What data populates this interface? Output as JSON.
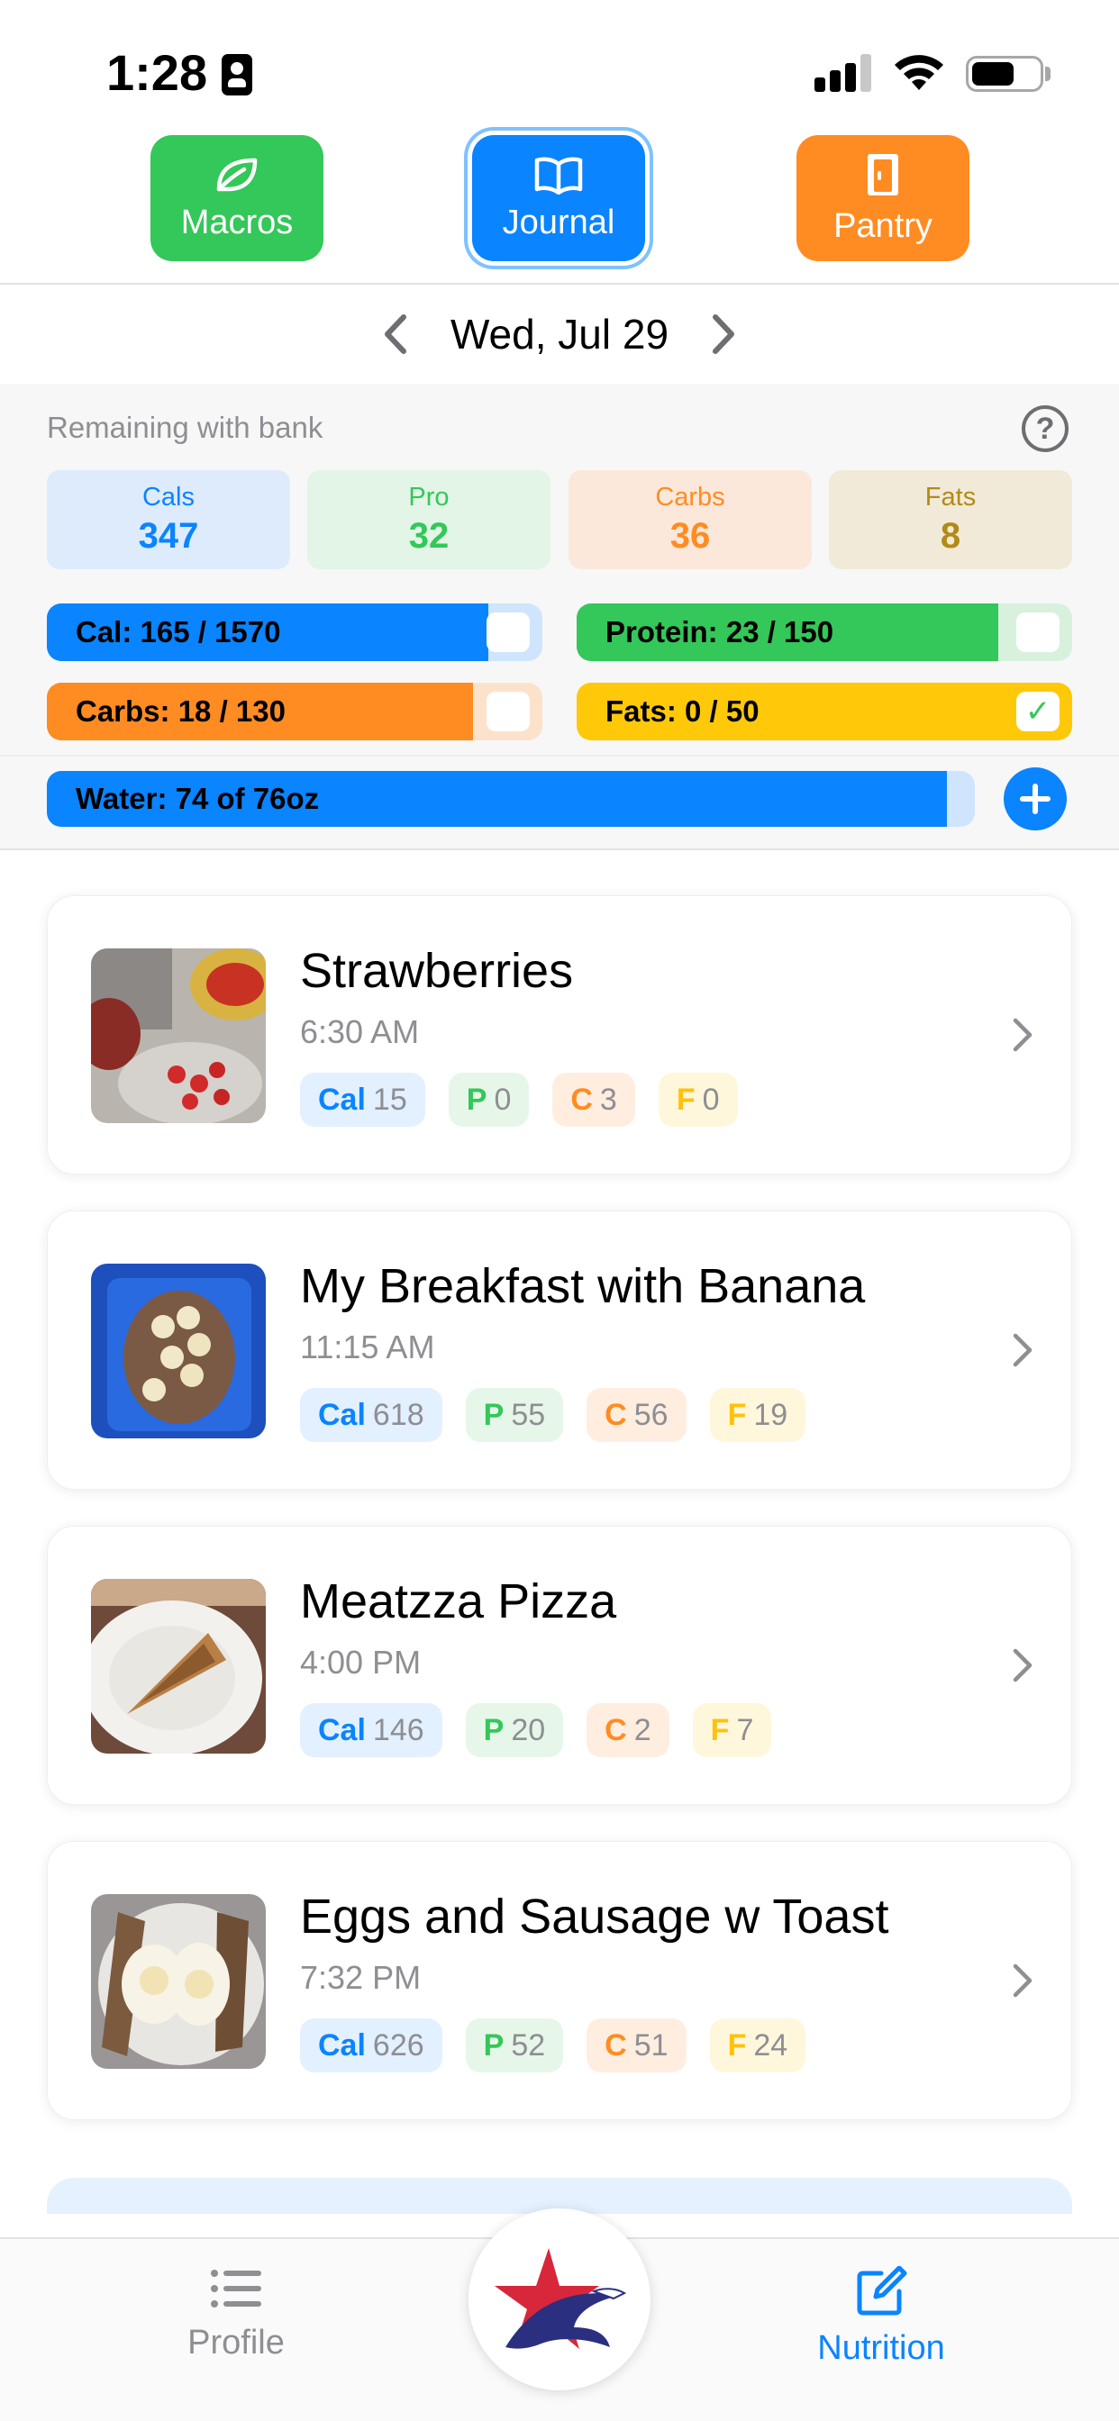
{
  "status_bar": {
    "time": "1:28"
  },
  "top_nav": {
    "macros_label": "Macros",
    "journal_label": "Journal",
    "pantry_label": "Pantry",
    "selected": "Journal"
  },
  "date_bar": {
    "date": "Wed, Jul 29"
  },
  "summary": {
    "remaining_label": "Remaining with bank",
    "remaining": [
      {
        "label": "Cals",
        "value": "347"
      },
      {
        "label": "Pro",
        "value": "32"
      },
      {
        "label": "Carbs",
        "value": "36"
      },
      {
        "label": "Fats",
        "value": "8"
      }
    ],
    "bars": {
      "calories": {
        "text": "Cal: 165 / 1570",
        "fill_fraction": 0.89
      },
      "protein": {
        "text": "Protein: 23 / 150",
        "fill_fraction": 0.85
      },
      "carbs": {
        "text": "Carbs: 18 / 130",
        "fill_fraction": 0.86
      },
      "fats": {
        "text": "Fats: 0 / 50",
        "fill_fraction": 1.0,
        "checked": true
      },
      "water": {
        "text": "Water: 74 of 76oz",
        "fill_fraction": 0.97
      }
    }
  },
  "meals": [
    {
      "name": "Strawberries",
      "time": "6:30 AM",
      "cal": "15",
      "pro": "0",
      "carb": "3",
      "fat": "0"
    },
    {
      "name": "My Breakfast with Banana",
      "time": "11:15 AM",
      "cal": "618",
      "pro": "55",
      "carb": "56",
      "fat": "19"
    },
    {
      "name": "Meatzza Pizza",
      "time": "4:00 PM",
      "cal": "146",
      "pro": "20",
      "carb": "2",
      "fat": "7"
    },
    {
      "name": "Eggs and Sausage w Toast",
      "time": "7:32 PM",
      "cal": "626",
      "pro": "52",
      "carb": "51",
      "fat": "24"
    }
  ],
  "chip_labels": {
    "cal": "Cal",
    "pro": "P",
    "carb": "C",
    "fat": "F"
  },
  "tab_bar": {
    "profile_label": "Profile",
    "nutrition_label": "Nutrition",
    "active": "Nutrition"
  },
  "colors": {
    "blue": "#0a84ff",
    "green": "#34c759",
    "orange": "#ff8c22",
    "yellow": "#ffc10a"
  }
}
